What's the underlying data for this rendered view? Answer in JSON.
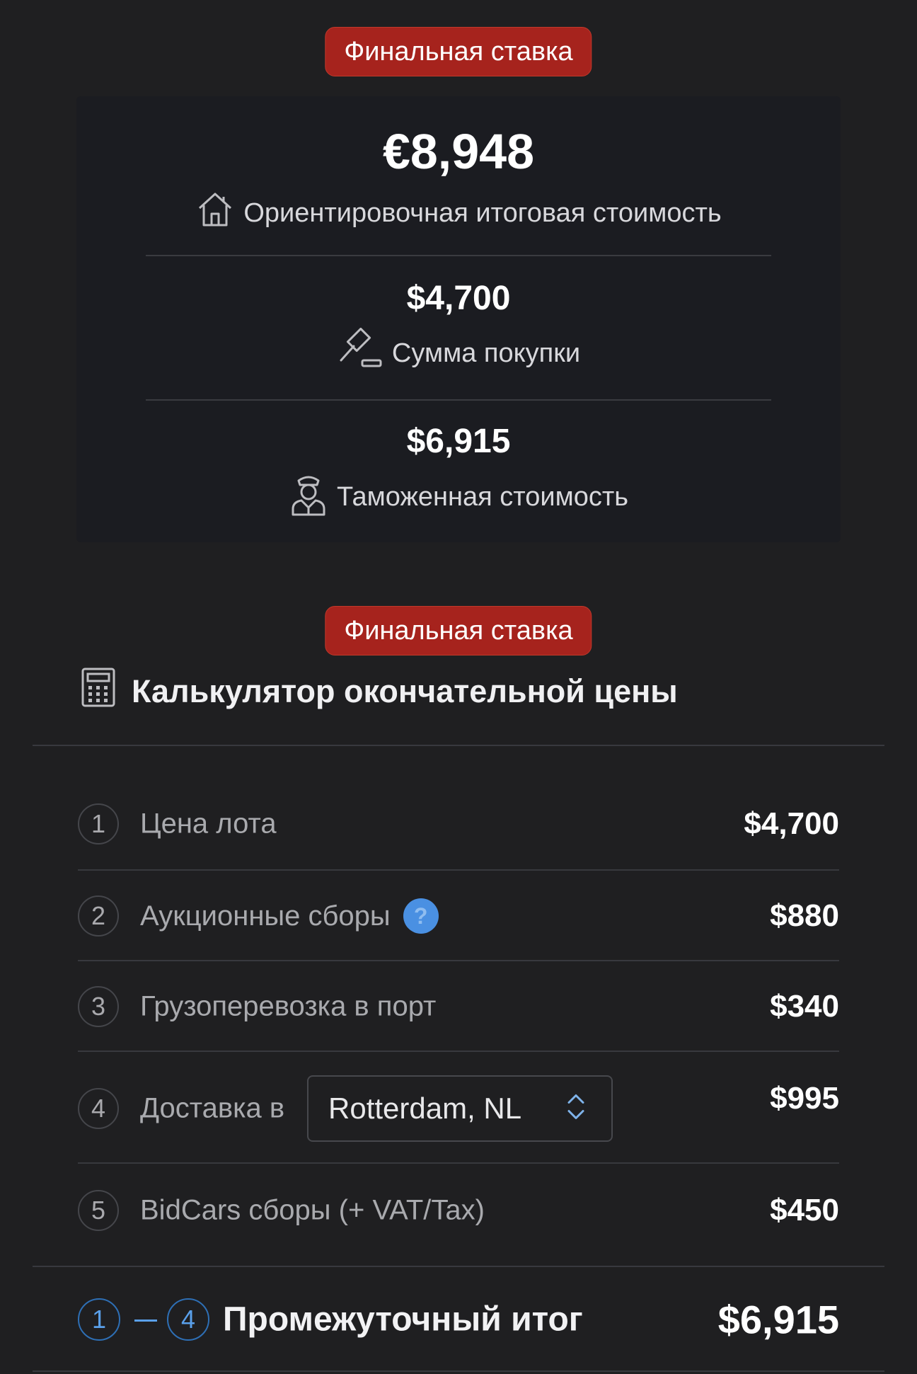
{
  "badges": {
    "final_bid_top": "Финальная ставка",
    "final_bid_calc": "Финальная ставка"
  },
  "summary": {
    "total": {
      "value": "€8,948",
      "label": "Ориентировочная итоговая стоимость",
      "icon": "house-icon"
    },
    "purchase": {
      "value": "$4,700",
      "label": "Сумма покупки",
      "icon": "gavel-icon"
    },
    "customs": {
      "value": "$6,915",
      "label": "Таможенная стоимость",
      "icon": "customs-officer-icon"
    }
  },
  "calculator": {
    "title": "Калькулятор окончательной цены",
    "icon": "calculator-icon",
    "rows": [
      {
        "num": "1",
        "label": "Цена лота",
        "value": "$4,700"
      },
      {
        "num": "2",
        "label": "Аукционные сборы",
        "value": "$880",
        "help": "?"
      },
      {
        "num": "3",
        "label": "Грузоперевозка в порт",
        "value": "$340"
      },
      {
        "num": "4",
        "label": "Доставка в",
        "value": "$995",
        "select_value": "Rotterdam, NL"
      },
      {
        "num": "5",
        "label": "BidCars сборы (+ VAT/Tax)",
        "value": "$450"
      }
    ],
    "subtotal": {
      "from": "1",
      "to": "4",
      "label": "Промежуточный итог",
      "value": "$6,915"
    }
  },
  "colors": {
    "background": "#1f1f21",
    "badge": "#a6231d",
    "accent_blue": "#4a90e2"
  }
}
